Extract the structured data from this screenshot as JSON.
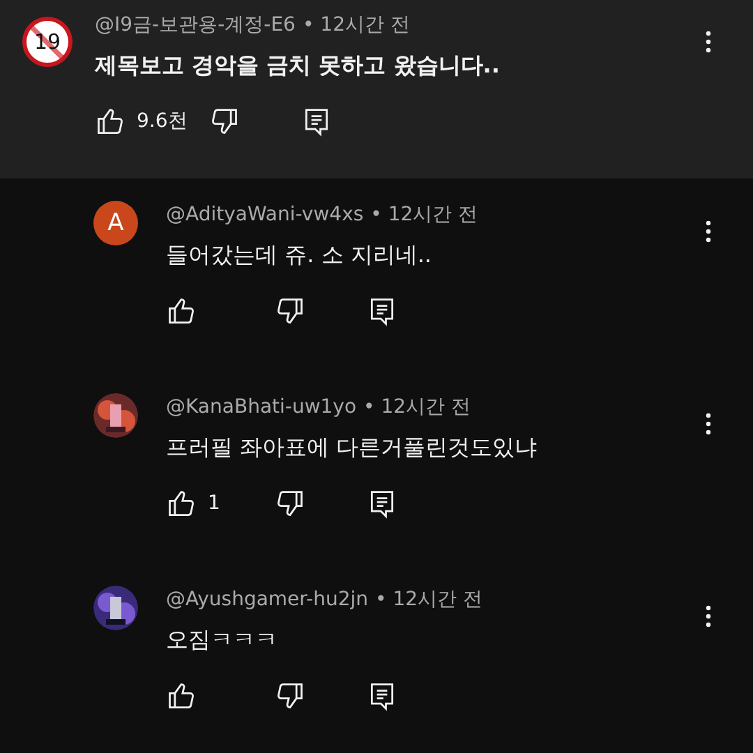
{
  "comment": {
    "avatar": {
      "kind": "age-badge",
      "text": "19"
    },
    "author": "@I9금-보관용-계정-E6",
    "time": "• 12시간 전",
    "text": "제목보고 경악을 금치 못하고 왔습니다..",
    "likes": "9.6천"
  },
  "replies": [
    {
      "avatar": {
        "kind": "letter",
        "text": "A",
        "color": "#c9471b"
      },
      "author": "@AdityaWani-vw4xs",
      "time": "• 12시간 전",
      "text": "들어갔는데 쥬. 소 지리네.."
    },
    {
      "author": "@KanaBhati-uw1yo",
      "time": "• 12시간 전",
      "text": "프러필 좌아표에 다른거풀린것도있냐",
      "likes": "1"
    },
    {
      "author": "@Ayushgamer-hu2jn",
      "time": "• 12시간 전",
      "text": "오짐ㅋㅋㅋ"
    }
  ]
}
